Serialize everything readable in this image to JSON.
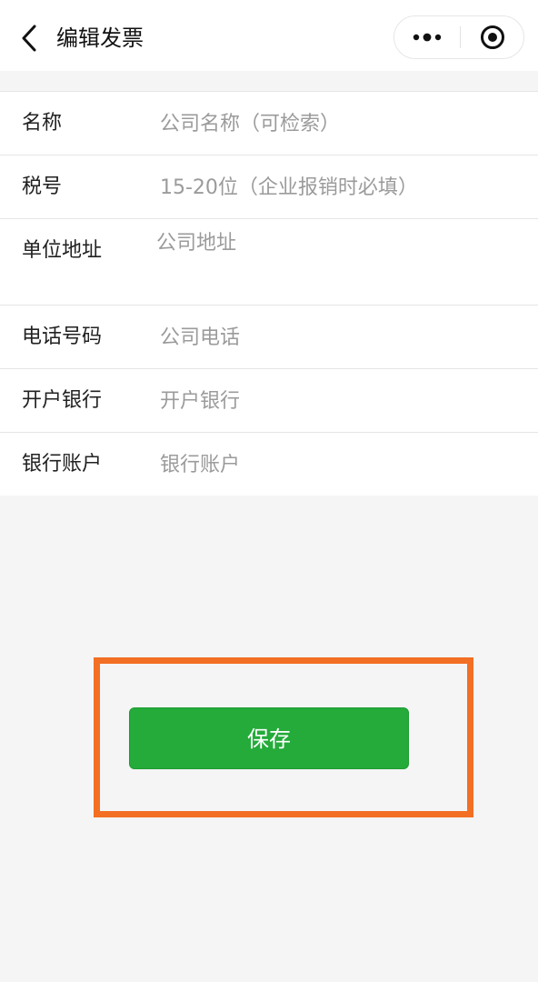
{
  "navbar": {
    "title": "编辑发票",
    "back_icon": "chevron-left-icon",
    "more_icon": "more-dots-icon",
    "close_icon": "target-close-icon"
  },
  "form": {
    "rows": [
      {
        "label": "名称",
        "value": "",
        "placeholder": "公司名称（可检索）"
      },
      {
        "label": "税号",
        "value": "",
        "placeholder": "15-20位（企业报销时必填）"
      },
      {
        "label": "单位地址",
        "value": "",
        "placeholder": "公司地址"
      },
      {
        "label": "电话号码",
        "value": "",
        "placeholder": "公司电话"
      },
      {
        "label": "开户银行",
        "value": "",
        "placeholder": "开户银行"
      },
      {
        "label": "银行账户",
        "value": "",
        "placeholder": "银行账户"
      }
    ]
  },
  "actions": {
    "save_label": "保存"
  },
  "colors": {
    "accent_green": "#24ab3a",
    "highlight_orange": "#f26f24",
    "background": "#f5f5f5"
  }
}
